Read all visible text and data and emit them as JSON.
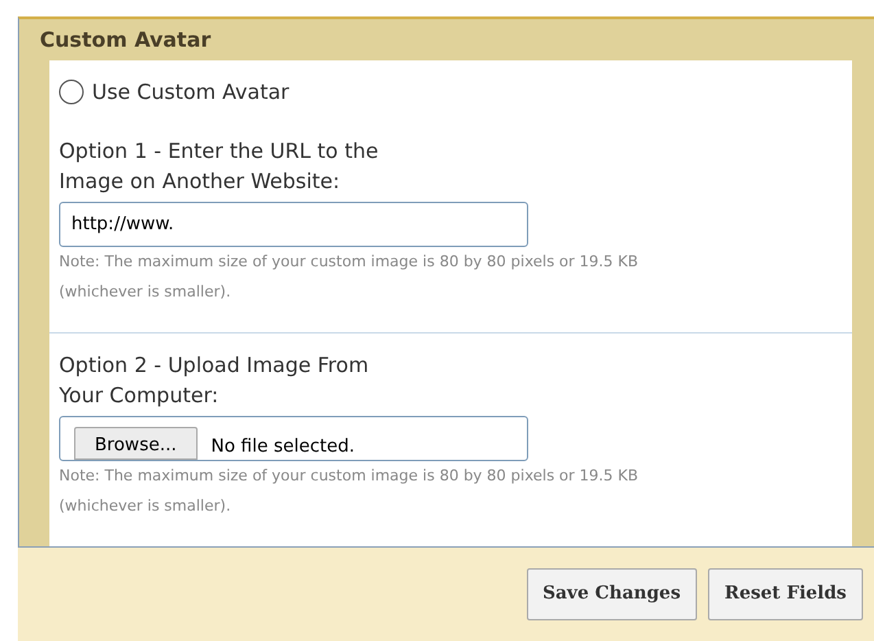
{
  "section": {
    "title": "Custom Avatar"
  },
  "radio": {
    "label": "Use Custom Avatar",
    "selected": false
  },
  "options": [
    {
      "kind": "url",
      "label_lines": [
        "Option 1 - Enter the URL to the",
        "Image on Another Website:"
      ],
      "value": "http://www.",
      "note_lines": [
        "Note: The maximum size of your custom image is 80 by 80 pixels or 19.5 KB",
        "(whichever is smaller)."
      ]
    },
    {
      "kind": "file",
      "label_lines": [
        "Option 2 - Upload Image From",
        "Your Computer:"
      ],
      "button": "Browse...",
      "status": "No file selected.",
      "note_lines": [
        "Note: The maximum size of your custom image is 80 by 80 pixels or 19.5 KB",
        "(whichever is smaller)."
      ]
    }
  ],
  "buttons": [
    "Save Changes",
    "Reset Fields"
  ]
}
